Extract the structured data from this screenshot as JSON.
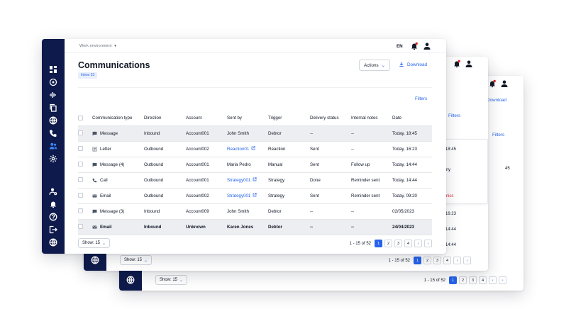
{
  "colors": {
    "rail": "#0e1a4b",
    "accent": "#2563eb",
    "row_highlight": "#eceef1",
    "danger": "#dc2626"
  },
  "topbar": {
    "workspace": "Work environment",
    "language": "EN"
  },
  "page": {
    "title": "Communications",
    "badge": "Inbox 23"
  },
  "actions_label": "Actions",
  "download_label": "Download",
  "filters_label": "Filters",
  "table": {
    "headers": [
      "Communication type",
      "Direction",
      "Account",
      "Sent by",
      "Trigger",
      "Delivery status",
      "Internal notes",
      "Date"
    ],
    "rows": [
      {
        "icon": "message-icon",
        "type": "Message",
        "direction": "Inbound",
        "account": "Account001",
        "sent_by": "John Smith",
        "sent_link": false,
        "trigger": "Debtor",
        "status": "--",
        "notes": "--",
        "date": "Today, 18:45",
        "highlight": true,
        "bold": false
      },
      {
        "icon": "letter-icon",
        "type": "Letter",
        "direction": "Outbound",
        "account": "Account002",
        "sent_by": "Reaction01",
        "sent_link": true,
        "trigger": "Reaction",
        "status": "Sent",
        "notes": "--",
        "date": "Today, 16:23",
        "highlight": false,
        "bold": false
      },
      {
        "icon": "message-icon",
        "type": "Message (4)",
        "direction": "Outbound",
        "account": "Account001",
        "sent_by": "Maria Pedro",
        "sent_link": false,
        "trigger": "Manual",
        "status": "Sent",
        "notes": "Follow up",
        "date": "Today, 14:44",
        "highlight": false,
        "bold": false
      },
      {
        "icon": "phone-icon",
        "type": "Call",
        "direction": "Outbound",
        "account": "Account001",
        "sent_by": "Strategy001",
        "sent_link": true,
        "trigger": "Strategy",
        "status": "Done",
        "notes": "Reminder sent",
        "date": "Today, 14:44",
        "highlight": false,
        "bold": false
      },
      {
        "icon": "email-icon",
        "type": "Email",
        "direction": "Outbound",
        "account": "Account002",
        "sent_by": "Strategy001",
        "sent_link": true,
        "trigger": "Strategy",
        "status": "Sent",
        "notes": "Reminder sent",
        "date": "Today, 09:20",
        "highlight": false,
        "bold": false
      },
      {
        "icon": "message-icon",
        "type": "Message (3)",
        "direction": "Inbound",
        "account": "Account009",
        "sent_by": "John Smith",
        "sent_link": false,
        "trigger": "Debtor",
        "status": "--",
        "notes": "--",
        "date": "02/05/2023",
        "highlight": false,
        "bold": false
      },
      {
        "icon": "email-icon",
        "type": "Email",
        "direction": "Inbound",
        "account": "Unknown",
        "sent_by": "Karen Jones",
        "sent_link": false,
        "trigger": "Debtor",
        "status": "--",
        "notes": "--",
        "date": "24/04/2023",
        "highlight": true,
        "bold": true
      }
    ]
  },
  "footer": {
    "show": "Show: 15",
    "range": "1 - 15 of 52",
    "pages": [
      "1",
      "2",
      "3",
      "4"
    ],
    "current": "1"
  },
  "back2": {
    "fragments": [
      "y, 18:45",
      "my",
      "smiss",
      "y, 16:23",
      "y, 14:44",
      "y, 14:44"
    ]
  },
  "back3": {
    "fragments": [
      "45"
    ]
  }
}
